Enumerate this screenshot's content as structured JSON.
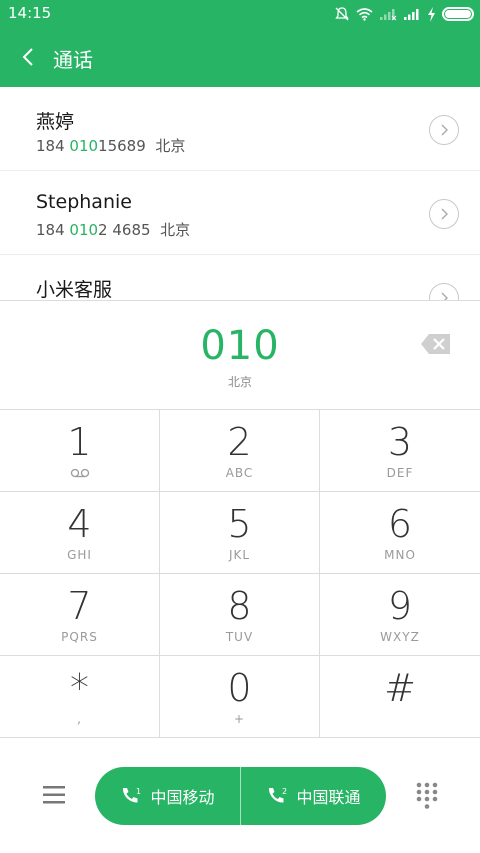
{
  "status": {
    "time": "14:15",
    "icons": [
      "mute-bell-icon",
      "wifi-icon",
      "signal-1-icon",
      "signal-2-icon",
      "charging-icon",
      "battery-icon"
    ]
  },
  "header": {
    "title": "通话",
    "back_icon": "back-arrow-icon"
  },
  "contacts": [
    {
      "name": "燕婷",
      "num_pre": "184 ",
      "num_hl": "010",
      "num_post": "15689",
      "location": "北京"
    },
    {
      "name": "Stephanie",
      "num_pre": "184 ",
      "num_hl": "010",
      "num_post": "2 4685",
      "location": "北京"
    },
    {
      "name": "小米客服",
      "num_pre": "",
      "num_hl": "",
      "num_post": "",
      "location": ""
    }
  ],
  "dialer": {
    "number": "010",
    "location": "北京",
    "backspace_icon": "backspace-icon"
  },
  "keypad": [
    {
      "digit": "1",
      "letters": ""
    },
    {
      "digit": "2",
      "letters": "ABC"
    },
    {
      "digit": "3",
      "letters": "DEF"
    },
    {
      "digit": "4",
      "letters": "GHI"
    },
    {
      "digit": "5",
      "letters": "JKL"
    },
    {
      "digit": "6",
      "letters": "MNO"
    },
    {
      "digit": "7",
      "letters": "PQRS"
    },
    {
      "digit": "8",
      "letters": "TUV"
    },
    {
      "digit": "9",
      "letters": "WXYZ"
    },
    {
      "digit": "*",
      "letters": ","
    },
    {
      "digit": "0",
      "letters": "+"
    },
    {
      "digit": "#",
      "letters": ""
    }
  ],
  "bottom": {
    "sim1_label": "中国移动",
    "sim2_label": "中国联通",
    "sim1_badge": "1",
    "sim2_badge": "2"
  },
  "colors": {
    "accent": "#27b464",
    "divider": "#dcdcdc"
  }
}
